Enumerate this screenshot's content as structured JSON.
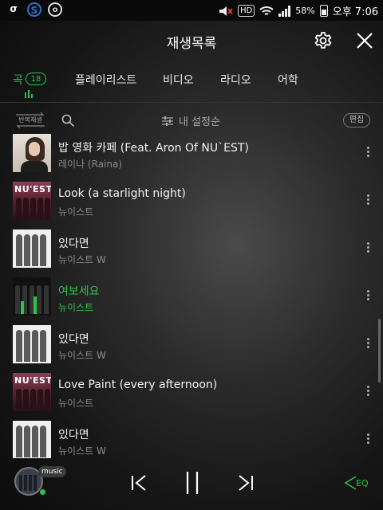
{
  "status_bar": {
    "apps": [
      "σ",
      "S",
      "o"
    ],
    "battery": "58%",
    "time": "오후 7:06",
    "hd_label": "HD",
    "icons": [
      "mute-icon",
      "hd-voice-icon",
      "wifi-icon",
      "signal-icon",
      "battery-icon"
    ]
  },
  "header": {
    "title": "재생목록"
  },
  "tabs": [
    {
      "label": "곡",
      "count": "18",
      "active": true
    },
    {
      "label": "플레이리스트",
      "active": false
    },
    {
      "label": "비디오",
      "active": false
    },
    {
      "label": "라디오",
      "active": false
    },
    {
      "label": "어학",
      "active": false
    }
  ],
  "toolbar": {
    "repeat_label": "반복재생",
    "sort_label": "내 설정순",
    "edit_label": "편집"
  },
  "songs": [
    {
      "title": "밥 영화 카페 (Feat. Aron Of NU`EST)",
      "artist": "레이나 (Raina)",
      "current": false
    },
    {
      "title": "Look (a starlight night)",
      "artist": "뉴이스트",
      "current": false
    },
    {
      "title": "있다면",
      "artist": "뉴이스트 W",
      "current": false
    },
    {
      "title": "여보세요",
      "artist": "뉴이스트",
      "current": true
    },
    {
      "title": "있다면",
      "artist": "뉴이스트 W",
      "current": false
    },
    {
      "title": "Love Paint (every afternoon)",
      "artist": "뉴이스트",
      "current": false
    },
    {
      "title": "있다면",
      "artist": "뉴이스트 W",
      "current": false
    }
  ],
  "album_logo": "NU'EST",
  "player": {
    "music_tag": "music",
    "eq_label": "EQ"
  },
  "colors": {
    "accent": "#2fc14a",
    "background": "#161616",
    "text_secondary": "#8a8a8a"
  }
}
